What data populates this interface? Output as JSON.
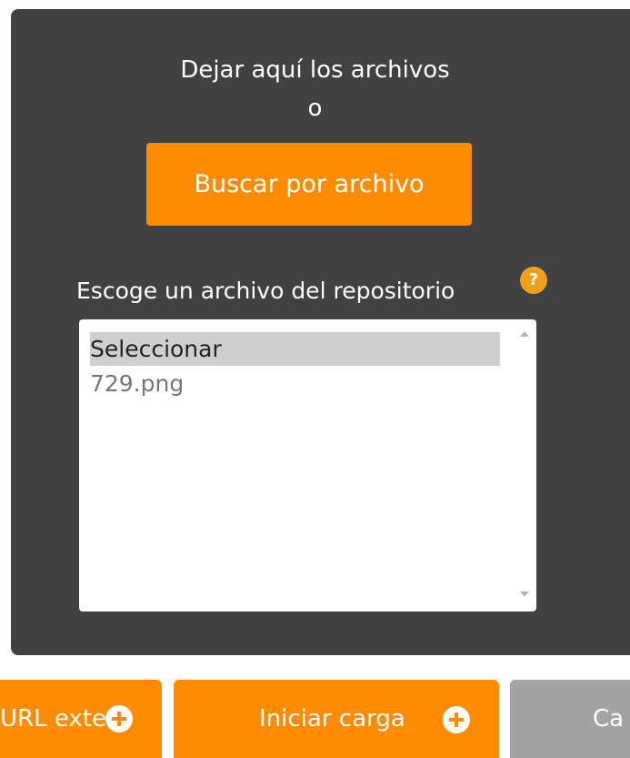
{
  "dropzone": {
    "drop_text": "Dejar aquí los archivos",
    "or_text": "o",
    "browse_button_label": "Buscar por archivo"
  },
  "repository": {
    "label": "Escoge un archivo del repositorio",
    "help_icon": "question-icon",
    "help_glyph": "?",
    "options": [
      "Seleccionar",
      "729.png"
    ],
    "selected": "Seleccionar"
  },
  "actions": {
    "external_url_label": "URL exter",
    "start_upload_label": "Iniciar carga",
    "cancel_label": "Ca"
  },
  "colors": {
    "panel_bg": "#414141",
    "accent": "#ff8c00",
    "disabled": "#a3a3a3"
  }
}
